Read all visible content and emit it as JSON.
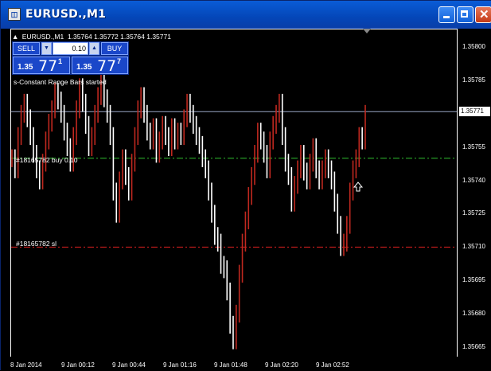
{
  "window": {
    "title": "EURUSD.,M1",
    "app_icon": "chart-window-icon",
    "min_icon": "minimize-icon",
    "max_icon": "maximize-icon",
    "close_icon": "close-icon"
  },
  "chart_header": {
    "symbol_tf": "EURUSD.,M1",
    "ohlc": "1.35764 1.35772 1.35764 1.35771"
  },
  "trade_panel": {
    "sell_label": "SELL",
    "buy_label": "BUY",
    "lot": "0.10",
    "sell_price_prefix": "1.35",
    "sell_price_big": "77",
    "sell_price_sup": "1",
    "buy_price_prefix": "1.35",
    "buy_price_big": "77",
    "buy_price_sup": "7"
  },
  "indicator_message": "s-Constant Range Bars started",
  "current_price_tag": "1.35771",
  "orders": [
    {
      "label": "#18165782 buy 0.10",
      "price": 1.3575,
      "color": "#2fbf2f"
    },
    {
      "label": "#18165782 sl",
      "price": 1.3571,
      "color": "#e02020"
    }
  ],
  "colors": {
    "up_bar": "#c0281f",
    "down_bar": "#ffffff",
    "bid_line": "#9aa8c8"
  },
  "chart_data": {
    "type": "bar",
    "symbol": "EURUSD.",
    "timeframe": "M1",
    "y_ticks": [
      "1.35800",
      "1.35785",
      "1.35771",
      "1.35755",
      "1.35740",
      "1.35725",
      "1.35710",
      "1.35695",
      "1.35680",
      "1.35665"
    ],
    "x_ticks": [
      "8 Jan 2014",
      "9 Jan 00:12",
      "9 Jan 00:44",
      "9 Jan 01:16",
      "9 Jan 01:48",
      "9 Jan 02:20",
      "9 Jan 02:52"
    ],
    "ylim": [
      1.35661,
      1.35808
    ],
    "bid": 1.35771,
    "close_series": [
      1.3575,
      1.35745,
      1.3576,
      1.3577,
      1.35775,
      1.35768,
      1.3576,
      1.35752,
      1.35745,
      1.3574,
      1.35748,
      1.35758,
      1.35766,
      1.35772,
      1.3578,
      1.35776,
      1.3577,
      1.35762,
      1.35755,
      1.35748,
      1.3576,
      1.35772,
      1.35782,
      1.35775,
      1.35765,
      1.35755,
      1.3576,
      1.3577,
      1.35778,
      1.35785,
      1.35777,
      1.3577,
      1.3576,
      1.35735,
      1.35725,
      1.3574,
      1.3575,
      1.35742,
      1.35735,
      1.35748,
      1.3576,
      1.35772,
      1.35778,
      1.3577,
      1.35762,
      1.35758,
      1.35764,
      1.35752,
      1.35758,
      1.35765,
      1.3576,
      1.35755,
      1.35764,
      1.35758,
      1.35762,
      1.3576,
      1.35768,
      1.35775,
      1.3577,
      1.35765,
      1.3576,
      1.35756,
      1.3575,
      1.35745,
      1.35735,
      1.35725,
      1.35715,
      1.35712,
      1.35702,
      1.357,
      1.3569,
      1.35675,
      1.35668,
      1.3568,
      1.35698,
      1.35712,
      1.35722,
      1.35733,
      1.35742,
      1.35752,
      1.35762,
      1.35758,
      1.35752,
      1.35745,
      1.35758,
      1.35765,
      1.3577,
      1.35775,
      1.3576,
      1.35748,
      1.35742,
      1.3573,
      1.35738,
      1.35745,
      1.35752,
      1.35744,
      1.3574,
      1.35748,
      1.35755,
      1.35745,
      1.3574,
      1.35745,
      1.3575,
      1.35745,
      1.3574,
      1.3573,
      1.3572,
      1.3571,
      1.35712,
      1.3572,
      1.35735,
      1.35745,
      1.3575,
      1.3576,
      1.35758,
      1.3577
    ]
  }
}
